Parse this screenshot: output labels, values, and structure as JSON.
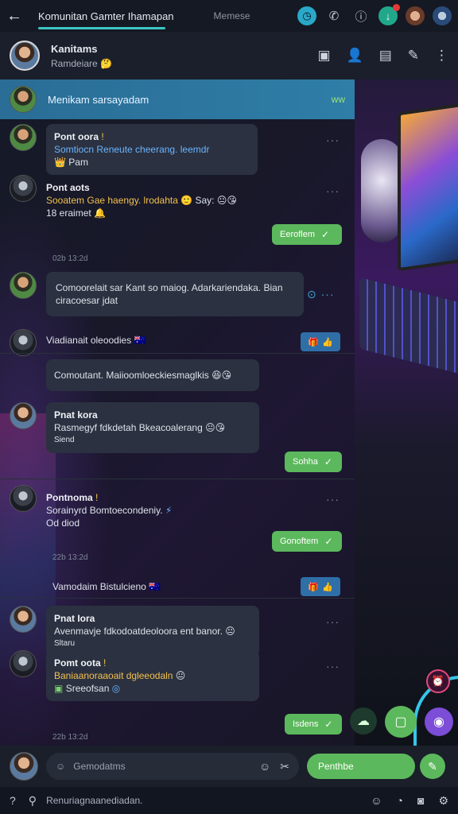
{
  "statusbar": {
    "title": "Komunitan Gamter Ihamapan",
    "sub": "Memese"
  },
  "chat_header": {
    "name": "Kanitams",
    "status": "Ramdeiare 🤔"
  },
  "pinned": {
    "label": "Menikam sarsayadam",
    "chevron": "ww"
  },
  "messages": [
    {
      "sender": "Pont oora",
      "line1": "Somtiocn Reneute cheerang. leemdr",
      "line2": "Pam"
    },
    {
      "sender": "Pont aots",
      "line1": "Sooatem Gae haengy. lrodahta",
      "line1b": "Say:",
      "line2": "18 eraimet"
    },
    {
      "text": "Comoorelait sar Kant so maiog. Adarkariendaka. Bian ciracoesar jdat"
    },
    {
      "text": "Viadianait oleoodies"
    },
    {
      "text": "Comoutant. Maiioomloeckiesmaglkis"
    },
    {
      "sender": "Pnat kora",
      "line1": "Rasmegyf fdkdetah Bkeacoalerang",
      "line2": "Siend"
    },
    {
      "sender": "Pontnoma",
      "line1": "Sorainyrd Bomtoecondeniy.",
      "line2": "Od diod"
    },
    {
      "text": "Vamodaim Bistulcieno"
    },
    {
      "sender": "Pnat Iora",
      "line1": "Avenmavje fdkodoatdeoloora ent banor.",
      "line2": "Sltaru"
    },
    {
      "sender": "Pomt oota",
      "line1": "Baniaanoraaoait dgleeodaln",
      "line2": "Sreeofsan"
    }
  ],
  "outgoing": [
    "Eeroflem",
    "Sohha",
    "Gonoftem",
    "Isdens"
  ],
  "timestamps": [
    "02b 13:2d",
    "22b 13:2d",
    "22b 13:2d"
  ],
  "input": {
    "placeholder": "Gemodatms",
    "send_label": "Penthbe"
  },
  "bottom_hint": "Renuriagnaanediadan.",
  "colors": {
    "accent": "#5cb85c",
    "pinned_bg": "#2e7ea7",
    "bubble_bg": "#2b3140",
    "highlight": "#f2c14e"
  }
}
